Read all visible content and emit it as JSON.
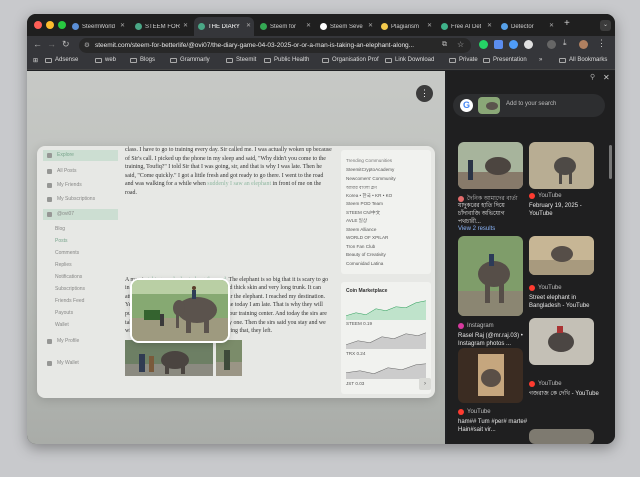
{
  "window": {
    "tabs": [
      {
        "label": "SteemWorld",
        "color": "#5b8fd6",
        "active": false
      },
      {
        "label": "STEEM FOR",
        "color": "#4aa786",
        "active": false
      },
      {
        "label": "THE DIARY",
        "color": "#4aa786",
        "active": true
      },
      {
        "label": "Steem for",
        "color": "#34a853",
        "active": false
      },
      {
        "label": "Steem Seve",
        "color": "#ffffff",
        "active": false
      },
      {
        "label": "Plagiarism",
        "color": "#f2c94c",
        "active": false
      },
      {
        "label": "Free AI Det",
        "color": "#3fb38a",
        "active": false
      },
      {
        "label": "Detector",
        "color": "#56a0e8",
        "active": false
      }
    ],
    "new_tab_label": "+",
    "url": "steemit.com/steem-for-betterlife/@ovi07/the-diary-game-04-03-2025-or-or-a-man-is-taking-an-elephant-along...",
    "bookmarks": [
      "Adsense",
      "web",
      "Blogs",
      "Grammarly",
      "Steemit",
      "Public Health",
      "Organisation Prof",
      "Link Download",
      "Private",
      "Presentation"
    ],
    "all_bookmarks_label": "All Bookmarks",
    "more_bookmarks": "»"
  },
  "steemit": {
    "nav": {
      "items": [
        {
          "label": "Explore",
          "type": "hl"
        },
        {
          "label": "All Posts",
          "type": "icon"
        },
        {
          "label": "My Friends",
          "type": "icon"
        },
        {
          "label": "My Subscriptions",
          "type": "icon"
        },
        {
          "label": "@ovi07",
          "type": "sel"
        },
        {
          "label": "Blog",
          "type": "sub"
        },
        {
          "label": "Posts",
          "type": "subact"
        },
        {
          "label": "Comments",
          "type": "sub"
        },
        {
          "label": "Replies",
          "type": "sub"
        },
        {
          "label": "Notifications",
          "type": "sub"
        },
        {
          "label": "Subscriptions",
          "type": "sub"
        },
        {
          "label": "Friends Feed",
          "type": "sub"
        },
        {
          "label": "Payouts",
          "type": "sub"
        },
        {
          "label": "Wallet",
          "type": "sub"
        },
        {
          "label": "My Profile",
          "type": "icon"
        },
        {
          "label": "My Wallet",
          "type": "icon"
        }
      ]
    },
    "article": {
      "para1": "class. I have to go to training every day. Sir called me. I was actually woken up because of Sir's call. I picked up the phone in my sleep and said, \"Why didn't you come to the training, Toufiq?\" I told Sir that I was going, sir, and that is why I was late. Then he said, \"Come quickly.\" I got a little fresh and got ready to go there. I went to the road and was walking for a while when",
      "para1_hl": "suddenly I saw an elephant",
      "para1_end": "in front of me on the road.",
      "para2_start": "A man is",
      "para2_hl": "taking an elephant along the road.",
      "para2": "The elephant is so big that it is scary to go in front of it because it has very big legs. And thick skin and very long trunk. It can attack at any time so it is better not to go near the elephant. I reached my destination. Yes, they made me stand for an hour. Because today I am late. That is why they will punish me. Tomorrow there was an exam at our training center. And today the sirs are taking everyone's bib. We all gave bib one by one. Then the sirs said you stay and we will give your results tomorrow. Without saying that, they left."
    },
    "trending": {
      "title": "Trending Communities",
      "items": [
        "SteemitCryptoAcademy",
        "Newcomers' Community",
        "আমার বাংলা ব্লগ",
        "Korea • 한국 • KR • KO",
        "Steem POD Team",
        "STEEM CN/中文",
        "AVLE 일상",
        "Steem Alliance",
        "WORLD OF XPILAR",
        "Tron Fan Club",
        "Beauty of Creativity",
        "Comunidad Latina"
      ]
    },
    "coin": {
      "title": "Coin Marketplace",
      "labels": [
        "STEEM 0.19",
        "TRX 0.24",
        "JST 0.03"
      ]
    }
  },
  "google_panel": {
    "search_placeholder": "Add to your search",
    "results": [
      {
        "source": "দৈনিক আমাদের বার্তা",
        "caption": "যাদুকরের হাতি দিয়ে চাঁদাবাজি অভিযোগ পথচারী...",
        "src_color": "#e36b6b"
      },
      {
        "source": "YouTube",
        "caption": "February 19, 2025 - YouTube",
        "src_color": "#ff3b30"
      },
      {
        "source": "",
        "caption": "View 2 results",
        "src_color": "#8ab4f8"
      },
      {
        "source": "Instagram",
        "caption": "Rasel Raj (@mr.raj.03) • Instagram photos ...",
        "src_color": "#d6399e"
      },
      {
        "source": "YouTube",
        "caption": "Street elephant in Bangladesh - YouTube",
        "src_color": "#ff3b30"
      },
      {
        "source": "YouTube",
        "caption": "গজরাজ কে দেখি - YouTube",
        "src_color": "#ff3b30"
      },
      {
        "source": "YouTube",
        "caption": "ham## Tum #per# marte# Hain#sait vir...",
        "src_color": "#ff3b30"
      }
    ]
  }
}
